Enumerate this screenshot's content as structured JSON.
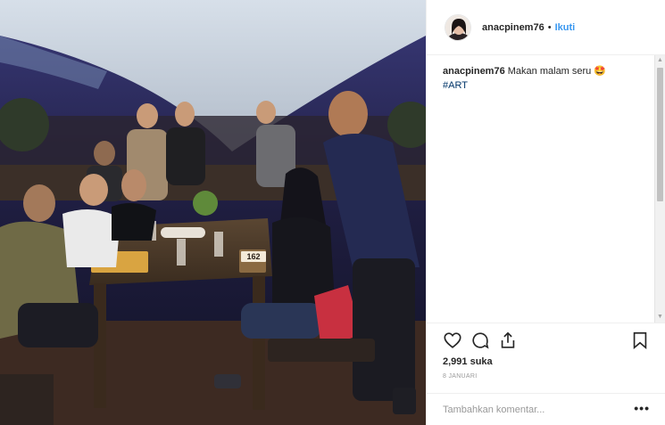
{
  "post": {
    "username": "anacpinem76",
    "separator": "•",
    "follow_label": "Ikuti",
    "caption": {
      "username": "anacpinem76",
      "text": "Makan malam seru",
      "emoji": "🤩",
      "hashtag": "#ART"
    },
    "likes": "2,991 suka",
    "date": "8 JANUARI",
    "add_comment_placeholder": "Tambahkan komentar...",
    "more_label": "•••",
    "photo": {
      "table_number": "162"
    }
  },
  "icons": {
    "like": "heart-icon",
    "comment": "comment-icon",
    "share": "share-icon",
    "save": "bookmark-icon",
    "more": "more-options-icon"
  },
  "colors": {
    "follow": "#3897f0",
    "hashtag": "#003569",
    "text": "#262626",
    "muted": "#999999",
    "border": "#efefef"
  }
}
